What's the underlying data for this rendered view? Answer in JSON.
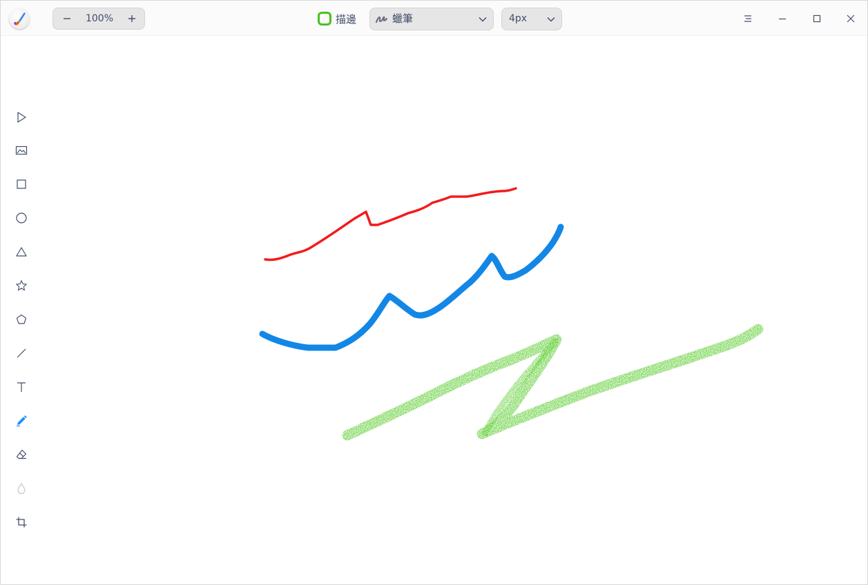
{
  "header": {
    "zoom": {
      "value": "100%"
    },
    "stroke_toggle": {
      "label": "描邊",
      "color": "#48c21d",
      "checked": true
    },
    "pen_type": {
      "label": "蠟筆",
      "icon": "crayon-icon"
    },
    "line_width": {
      "label": "4px"
    }
  },
  "window_controls": [
    "menu-icon",
    "minimize-icon",
    "maximize-icon",
    "close-icon"
  ],
  "tools": [
    {
      "name": "select",
      "icon": "cursor-icon",
      "active": false
    },
    {
      "name": "image",
      "icon": "image-icon",
      "active": false
    },
    {
      "name": "rectangle",
      "icon": "rectangle-icon",
      "active": false
    },
    {
      "name": "ellipse",
      "icon": "circle-icon",
      "active": false
    },
    {
      "name": "triangle",
      "icon": "triangle-icon",
      "active": false
    },
    {
      "name": "star",
      "icon": "star-icon",
      "active": false
    },
    {
      "name": "polygon",
      "icon": "pentagon-icon",
      "active": false
    },
    {
      "name": "line",
      "icon": "line-icon",
      "active": false
    },
    {
      "name": "text",
      "icon": "text-icon",
      "active": false
    },
    {
      "name": "pen",
      "icon": "pen-icon",
      "active": true
    },
    {
      "name": "eraser",
      "icon": "eraser-icon",
      "active": false
    },
    {
      "name": "blur",
      "icon": "blur-drop-icon",
      "active": false,
      "disabled": true
    },
    {
      "name": "crop",
      "icon": "crop-icon",
      "active": false
    }
  ],
  "colors": {
    "accent": "#1e90ff",
    "stroke_red": "#f21b1b",
    "stroke_blue": "#1387e6",
    "stroke_green": "#4fc91f"
  }
}
